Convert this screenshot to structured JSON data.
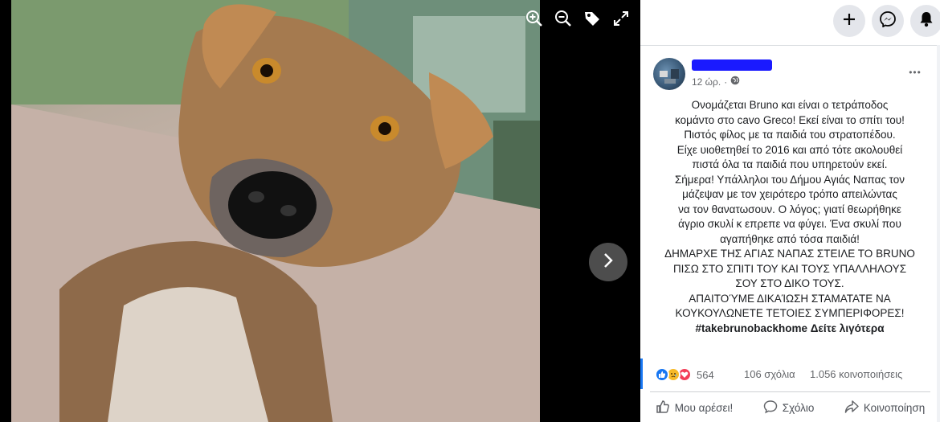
{
  "viewer": {
    "tools": [
      {
        "icon": "zoom-in-icon"
      },
      {
        "icon": "zoom-out-icon"
      },
      {
        "icon": "tag-icon"
      },
      {
        "icon": "fullscreen-icon"
      }
    ],
    "next_icon": "chevron-right-icon"
  },
  "topbar": {
    "create_icon": "plus-icon",
    "messenger_icon": "messenger-icon",
    "notifications_icon": "bell-icon"
  },
  "post": {
    "author_name": "",
    "time": "12 ώρ.",
    "separator": "·",
    "audience_icon": "globe-icon",
    "more_label": "•••",
    "text_lines": [
      "Ονομάζεται Bruno και είναι ο τετράποδος",
      "κομάντο στο cavo Greco! Εκεί είναι το σπίτι του!",
      "Πιστός φίλος με τα παιδιά του στρατοπέδου.",
      "Είχε υιοθετηθεί το 2016 και από τότε ακολουθεί",
      "πιστά όλα τα παιδιά που υπηρετούν εκεί.",
      "Σήμερα! Υπάλληλοι του Δήμου Αγιάς Ναπας τον",
      "μάζεψαν με τον χειρότερο τρόπο απειλώντας",
      "να τον θανατωσουν. Ο λόγος; γιατί θεωρήθηκε",
      "άγριο σκυλί κ επρεπε να φύγει. Ένα σκυλί που",
      "αγαπήθηκε από τόσα παιδιά!",
      "ΔΗΜΑΡΧΕ ΤΗΣ ΑΓΙΑΣ ΝΑΠΑΣ ΣΤΕΙΛΕ ΤΟ BRUNO",
      "ΠΙΣΩ ΣΤΟ ΣΠΙΤΙ ΤΟΥ ΚΑΙ ΤΟΥΣ ΥΠΑΛΛΗΛΟΥΣ",
      "ΣΟΥ ΣΤΟ ΔΙΚΟ ΤΟΥΣ.",
      "ΑΠΑΙΤΟΎΜΕ ΔΙΚΑΊΩΣΗ ΣΤΑΜΑΤΑΤΕ ΝΑ",
      "ΚΟΥΚΟΥΛΩΝΕΤΕ ΤΕΤΟΙΕΣ ΣΥΜΠΕΡΙΦΟΡΕΣ!"
    ],
    "hashtag": "#takebrunobackhome",
    "see_more": "Δείτε λιγότερα"
  },
  "stats": {
    "reaction_icons": [
      "like-reaction-icon",
      "sad-reaction-icon",
      "love-reaction-icon"
    ],
    "reactions_count": "564",
    "comments": "106 σχόλια",
    "shares": "1.056 κοινοποιήσεις"
  },
  "actions": {
    "like": "Μου αρέσει!",
    "comment": "Σχόλιο",
    "share": "Κοινοποίηση"
  },
  "colors": {
    "accent": "#1877f2",
    "panel_bg": "#ffffff",
    "viewer_bg": "#000000",
    "redaction": "#1a1aff"
  }
}
